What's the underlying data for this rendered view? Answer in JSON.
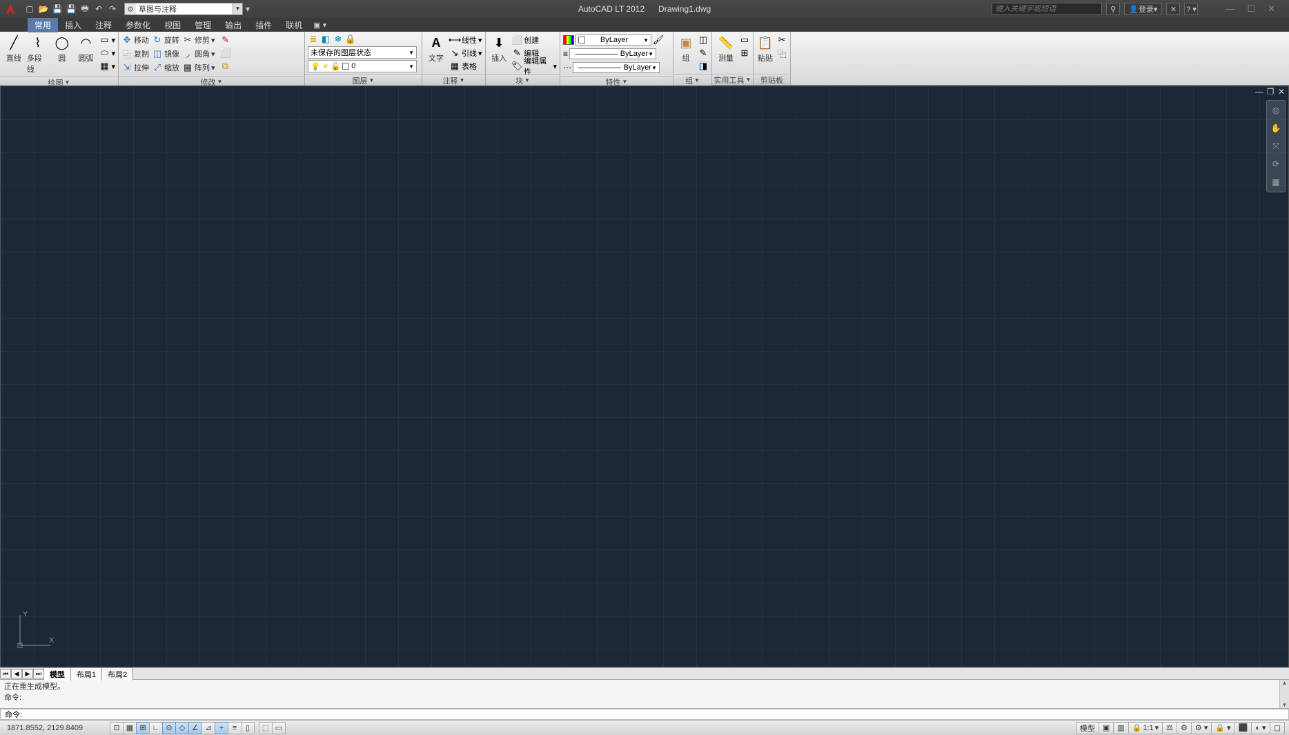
{
  "title": {
    "app": "AutoCAD LT 2012",
    "file": "Drawing1.dwg"
  },
  "workspace": "草图与注释",
  "search_placeholder": "键入关键字或短语",
  "signin": "登录",
  "menus": [
    "常用",
    "插入",
    "注释",
    "参数化",
    "视图",
    "管理",
    "输出",
    "插件",
    "联机"
  ],
  "panels": {
    "draw": {
      "title": "绘图",
      "items": [
        "直线",
        "多段线",
        "圆",
        "圆弧"
      ]
    },
    "modify": {
      "title": "修改",
      "items": [
        "移动",
        "旋转",
        "修剪",
        "复制",
        "镜像",
        "圆角",
        "拉伸",
        "缩放",
        "阵列"
      ]
    },
    "layers": {
      "title": "图层",
      "unsaved": "未保存的图层状态",
      "layer0": "0"
    },
    "annotation": {
      "title": "注释",
      "text": "文字",
      "items": [
        "线性",
        "引线",
        "表格"
      ]
    },
    "block": {
      "title": "块",
      "insert": "插入",
      "items": [
        "创建",
        "编辑",
        "编辑属性"
      ]
    },
    "properties": {
      "title": "特性",
      "bylayer": "ByLayer"
    },
    "group": {
      "title": "组",
      "label": "组"
    },
    "utilities": {
      "title": "实用工具",
      "label": "测量"
    },
    "clipboard": {
      "title": "剪贴板",
      "label": "粘贴"
    }
  },
  "layout_tabs": [
    "模型",
    "布局1",
    "布局2"
  ],
  "command": {
    "line1": "正在重生成模型。",
    "prompt": "命令:",
    "input": "命令:"
  },
  "status": {
    "coords": "1871.8552, 2129.8409",
    "model": "模型",
    "scale": "1:1"
  }
}
